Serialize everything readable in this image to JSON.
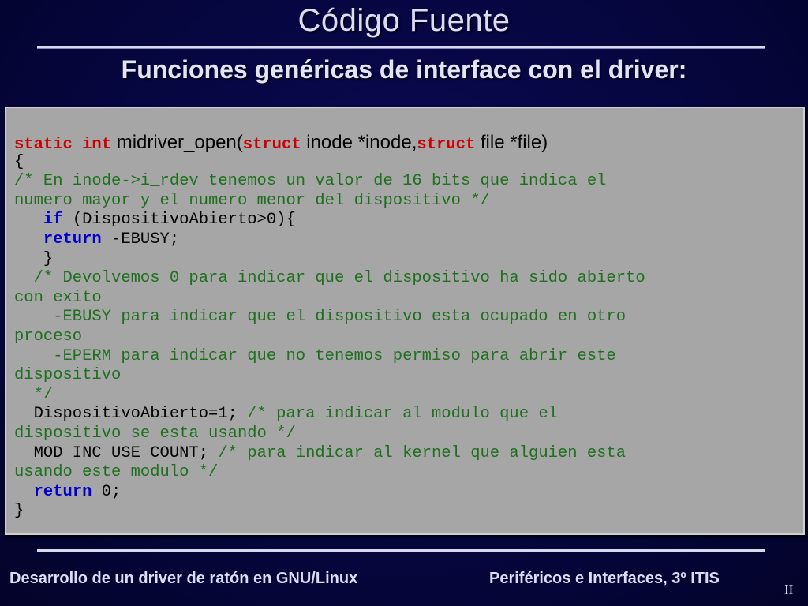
{
  "slide": {
    "title": "Código Fuente",
    "subtitle": "Funciones genéricas de interface con el driver:"
  },
  "code": {
    "l1": {
      "kw1": "static int",
      "sig1": " midriver_open(",
      "kw2": "struct",
      "sig2": " inode *inode,",
      "kw3": "struct",
      "sig3": " file *file)"
    },
    "l2": "{",
    "l3": "/* En inode->i_rdev tenemos un valor de 16 bits que indica el",
    "l4": "numero mayor y el numero menor del dispositivo */",
    "l5": {
      "indent": "   ",
      "kw": "if",
      "rest": " (DispositivoAbierto>0){"
    },
    "l6": {
      "indent": "   ",
      "kw": "return",
      "rest": " -EBUSY;"
    },
    "l7": "   }",
    "l8": "  /* Devolvemos 0 para indicar que el dispositivo ha sido abierto",
    "l9": "con exito",
    "l10": "    -EBUSY para indicar que el dispositivo esta ocupado en otro",
    "l11": "proceso",
    "l12": "    -EPERM para indicar que no tenemos permiso para abrir este",
    "l13": "dispositivo",
    "l14": "  */",
    "l15": {
      "code": "  DispositivoAbierto=1;",
      "comment": " /* para indicar al modulo que el"
    },
    "l16": "dispositivo se esta usando */",
    "l17": {
      "code": "  MOD_INC_USE_COUNT;",
      "comment": " /* para indicar al kernel que alguien esta"
    },
    "l18": "usando este modulo */",
    "l19": {
      "indent": "  ",
      "kw": "return",
      "rest": " 0;"
    },
    "l20": "}"
  },
  "footer": {
    "left": "Desarrollo de un driver de ratón en GNU/Linux",
    "right": "Periféricos e Interfaces, 3º ITIS",
    "page": "II"
  },
  "colors": {
    "background": "#060640",
    "code_box": "#a6a6a6",
    "keyword_red": "#cc0000",
    "keyword_blue": "#0000cc",
    "comment_green": "#1f6f1f"
  }
}
